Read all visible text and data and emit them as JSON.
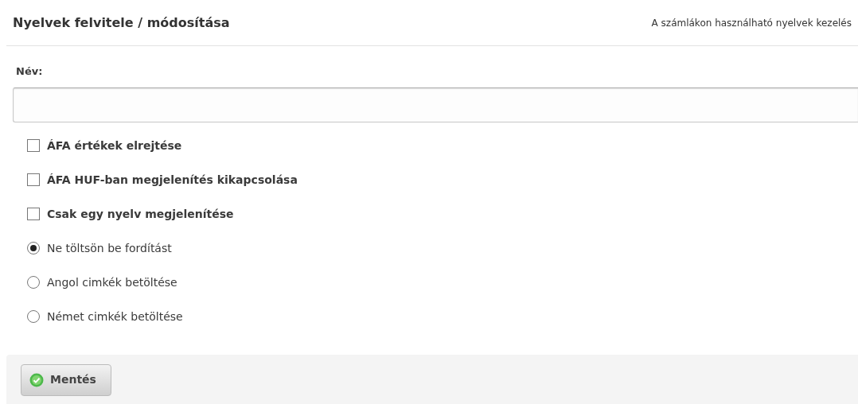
{
  "header": {
    "title": "Nyelvek felvitele / módosítása",
    "subtitle": "A számlákon használható nyelvek kezelés"
  },
  "name_field": {
    "label": "Név:"
  },
  "options": [
    {
      "kind": "checkbox",
      "label": "ÁFA értékek elrejtése",
      "checked": false
    },
    {
      "kind": "checkbox",
      "label": "ÁFA HUF-ban megjelenítés kikapcsolása",
      "checked": false
    },
    {
      "kind": "checkbox",
      "label": "Csak egy nyelv megjelenítése",
      "checked": false
    },
    {
      "kind": "radio",
      "label": "Ne töltsön be fordítást",
      "selected": true
    },
    {
      "kind": "radio",
      "label": "Angol cimkék betöltése",
      "selected": false
    },
    {
      "kind": "radio",
      "label": "Német cimkék betöltése",
      "selected": false
    }
  ],
  "footer": {
    "save_button": "Mentés"
  }
}
